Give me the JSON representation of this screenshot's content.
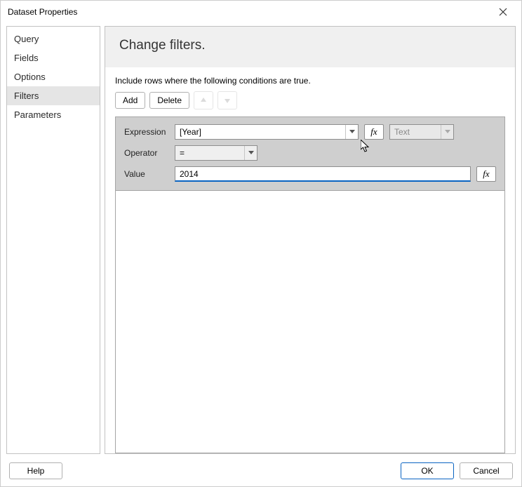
{
  "title": "Dataset Properties",
  "sidebar": {
    "items": [
      {
        "label": "Query"
      },
      {
        "label": "Fields"
      },
      {
        "label": "Options"
      },
      {
        "label": "Filters"
      },
      {
        "label": "Parameters"
      }
    ]
  },
  "header": {
    "title": "Change filters."
  },
  "instruction": "Include rows where the following conditions are true.",
  "toolbar": {
    "add": "Add",
    "delete": "Delete"
  },
  "filter": {
    "expression_label": "Expression",
    "expression_value": "[Year]",
    "operator_label": "Operator",
    "operator_value": "=",
    "value_label": "Value",
    "value_value": "2014",
    "type_text": "Text",
    "fx": "fx"
  },
  "footer": {
    "help": "Help",
    "ok": "OK",
    "cancel": "Cancel"
  }
}
